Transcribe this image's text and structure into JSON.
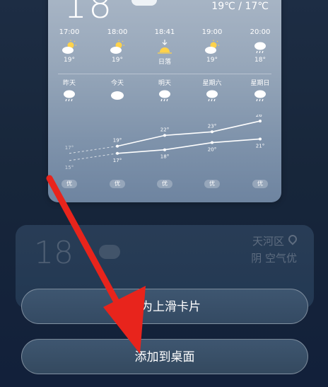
{
  "current": {
    "temp": "18",
    "range": "19℃ / 17℃"
  },
  "hourly": [
    {
      "time": "17:00",
      "icon": "partly-cloudy-sun-icon",
      "value": "19°"
    },
    {
      "time": "18:00",
      "icon": "partly-cloudy-sun-icon",
      "value": "19°"
    },
    {
      "time": "18:41",
      "icon": "sunset-icon",
      "value": "日落"
    },
    {
      "time": "19:00",
      "icon": "partly-cloudy-sun-icon",
      "value": "19°"
    },
    {
      "time": "20:00",
      "icon": "cloud-rain-icon",
      "value": "18°"
    }
  ],
  "daily": [
    {
      "day": "昨天",
      "icon": "cloud-rain-icon"
    },
    {
      "day": "今天",
      "icon": "cloud-icon"
    },
    {
      "day": "明天",
      "icon": "cloud-rain-icon"
    },
    {
      "day": "星期六",
      "icon": "cloud-rain-icon"
    },
    {
      "day": "星期日",
      "icon": "cloud-rain-icon"
    }
  ],
  "chart_data": {
    "type": "line",
    "categories": [
      "昨天",
      "今天",
      "明天",
      "星期六",
      "星期日"
    ],
    "series": [
      {
        "values": [
          17,
          19,
          22,
          23,
          26
        ]
      },
      {
        "values": [
          15,
          17,
          18,
          20,
          21
        ]
      }
    ],
    "high_labels": [
      "17°",
      "19°",
      "22°",
      "23°",
      "26°"
    ],
    "low_labels": [
      "15°",
      "17°",
      "18°",
      "20°",
      "21°"
    ],
    "aqi": [
      "优",
      "优",
      "优",
      "优",
      "优"
    ]
  },
  "ghost_card": {
    "temp": "18",
    "location": "天河区",
    "condition": "阴 空气优"
  },
  "buttons": {
    "set_swipe": "设为上滑卡片",
    "add_desktop": "添加到桌面"
  },
  "colors": {
    "background": "#1d2d44",
    "card": "#97a7ba",
    "button": "#3e5670",
    "arrow": "#e8241c"
  }
}
